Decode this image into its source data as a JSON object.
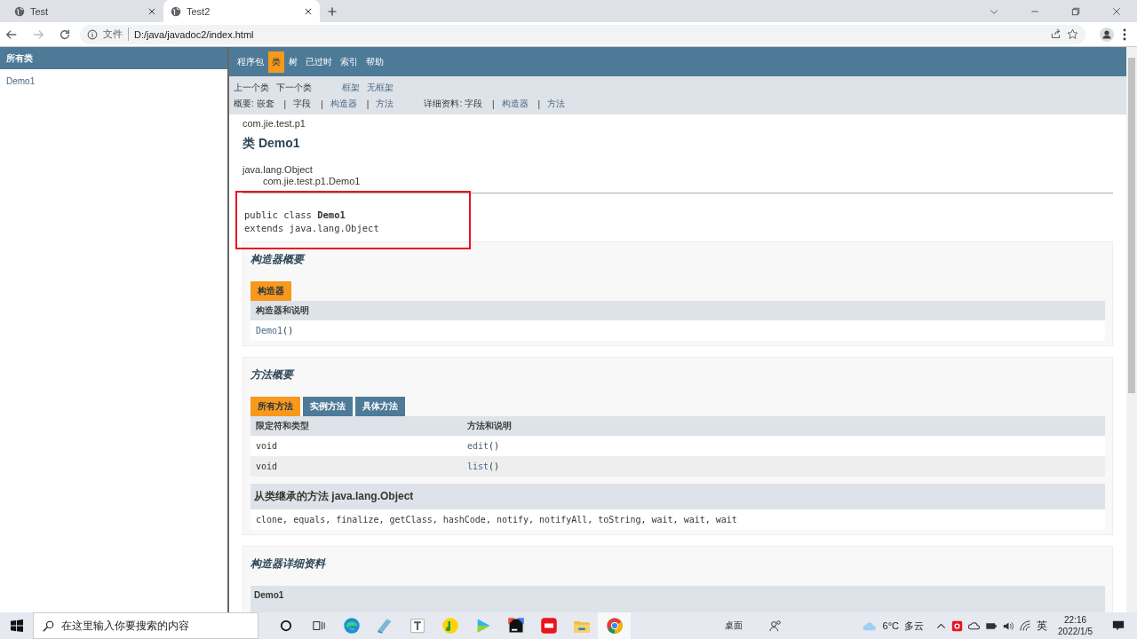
{
  "browser": {
    "tabs": [
      {
        "title": "Test",
        "selected": false
      },
      {
        "title": "Test2",
        "selected": true
      }
    ],
    "address": {
      "scheme": "文件",
      "url": "D:/java/javadoc2/index.html"
    }
  },
  "class_list": {
    "heading": "所有类",
    "items": [
      "Demo1"
    ]
  },
  "nav": {
    "items": [
      {
        "label": "程序包",
        "selected": false
      },
      {
        "label": "类",
        "selected": true
      },
      {
        "label": "树",
        "selected": false
      },
      {
        "label": "已过时",
        "selected": false
      },
      {
        "label": "索引",
        "selected": false
      },
      {
        "label": "帮助",
        "selected": false
      }
    ],
    "prev_next": [
      "上一个类",
      "下一个类"
    ],
    "frames": [
      "框架",
      "无框架"
    ],
    "summary": {
      "label": "概要:",
      "separator": "|",
      "items": [
        {
          "label": "嵌套",
          "link": false
        },
        {
          "label": "字段",
          "link": false
        },
        {
          "label": "构造器",
          "link": true
        },
        {
          "label": "方法",
          "link": true
        }
      ]
    },
    "detail": {
      "label": "详细资料:",
      "separator": "|",
      "items": [
        {
          "label": "字段",
          "link": false
        },
        {
          "label": "构造器",
          "link": true
        },
        {
          "label": "方法",
          "link": true
        }
      ]
    }
  },
  "content": {
    "package": "com.jie.test.p1",
    "title": "类 Demo1",
    "inheritance": [
      "java.lang.Object",
      "com.jie.test.p1.Demo1"
    ],
    "signature": {
      "highlighted": true,
      "lines": [
        "public class **Demo1**",
        "extends java.lang.Object"
      ]
    },
    "constructor_summary": {
      "title": "构造器概要",
      "tabs": [
        {
          "label": "构造器",
          "selected": true
        }
      ],
      "columns": [
        "构造器和说明"
      ],
      "rows": [
        {
          "name": "Demo1",
          "params": "()"
        }
      ]
    },
    "method_summary": {
      "title": "方法概要",
      "tabs": [
        {
          "label": "所有方法",
          "selected": true
        },
        {
          "label": "实例方法",
          "selected": false
        },
        {
          "label": "具体方法",
          "selected": false
        }
      ],
      "columns": [
        "限定符和类型",
        "方法和说明"
      ],
      "rows": [
        {
          "type": "void",
          "name": "edit",
          "params": "()"
        },
        {
          "type": "void",
          "name": "list",
          "params": "()"
        }
      ],
      "inherited": {
        "title": "从类继承的方法 java.lang.Object",
        "methods": "clone, equals, finalize, getClass, hashCode, notify, notifyAll, toString, wait, wait, wait"
      }
    },
    "constructor_detail": {
      "title": "构造器详细资料",
      "items": [
        "Demo1"
      ]
    }
  },
  "taskbar": {
    "search_placeholder": "在这里输入你要搜索的内容",
    "apps": [
      {
        "kind": "edge",
        "selected": false
      },
      {
        "kind": "notepad",
        "selected": false
      },
      {
        "kind": "typora",
        "selected": false
      },
      {
        "kind": "music",
        "selected": false
      },
      {
        "kind": "video",
        "selected": false
      },
      {
        "kind": "ide",
        "selected": false
      },
      {
        "kind": "dictionary",
        "selected": false
      },
      {
        "kind": "folder",
        "selected": false
      },
      {
        "kind": "chrome",
        "selected": true
      }
    ],
    "desktop": "桌面",
    "temperature": "6°C",
    "weather": "多云",
    "ime": "英",
    "time": "22:16",
    "date": "2022/1/5"
  }
}
